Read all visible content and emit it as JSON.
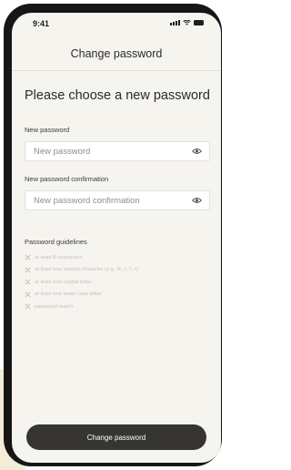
{
  "status_bar": {
    "time": "9:41",
    "icons": [
      "signal-icon",
      "wifi-icon",
      "battery-icon"
    ]
  },
  "nav": {
    "title": "Change password"
  },
  "heading": "Please choose a new password",
  "fields": [
    {
      "label": "New password",
      "placeholder": "New password",
      "value": "",
      "icon": "eye-icon"
    },
    {
      "label": "New password confirmation",
      "placeholder": "New password confirmation",
      "value": "",
      "icon": "eye-icon"
    }
  ],
  "guidelines": {
    "title": "Password guidelines",
    "icon": "x-icon",
    "items": [
      "at least 8 characters",
      "at least one special character (e.g. %, \\, ?, •)",
      "at least one capital letter",
      "at least one lower case letter",
      "password match"
    ]
  },
  "submit_label": "Change password",
  "colors": {
    "screen_bg": "#f6f4ef",
    "button_bg": "#363532",
    "guideline_inactive": "#c4c2bd",
    "frame": "#161616"
  }
}
